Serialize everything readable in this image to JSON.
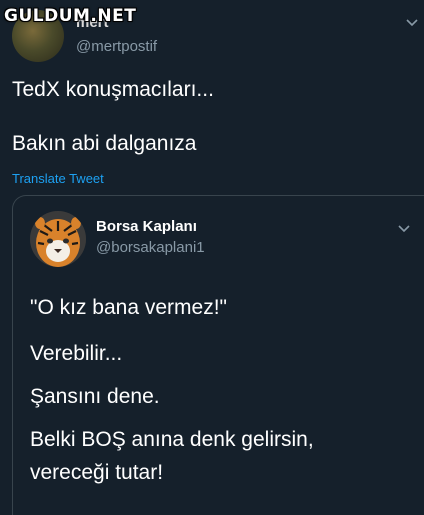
{
  "watermark": "GULDUM.NET",
  "top_tweet": {
    "name": "mert",
    "handle": "@mertpostif",
    "lines": [
      "TedX konuşmacıları...",
      "Bakın abi dalganıza"
    ],
    "translate_label": "Translate Tweet"
  },
  "quoted_tweet": {
    "name": "Borsa Kaplanı",
    "handle": "@borsakaplani1",
    "lines": [
      "\"O kız bana vermez!\"",
      "Verebilir...",
      "Şansını dene.",
      "Belki BOŞ anına denk gelirsin,",
      "vereceği tutar!"
    ]
  },
  "colors": {
    "background": "#15202b",
    "link": "#1da1f2",
    "secondary_text": "#8899a6",
    "border": "#38444d"
  },
  "icons": [
    "chevron-down-icon"
  ]
}
